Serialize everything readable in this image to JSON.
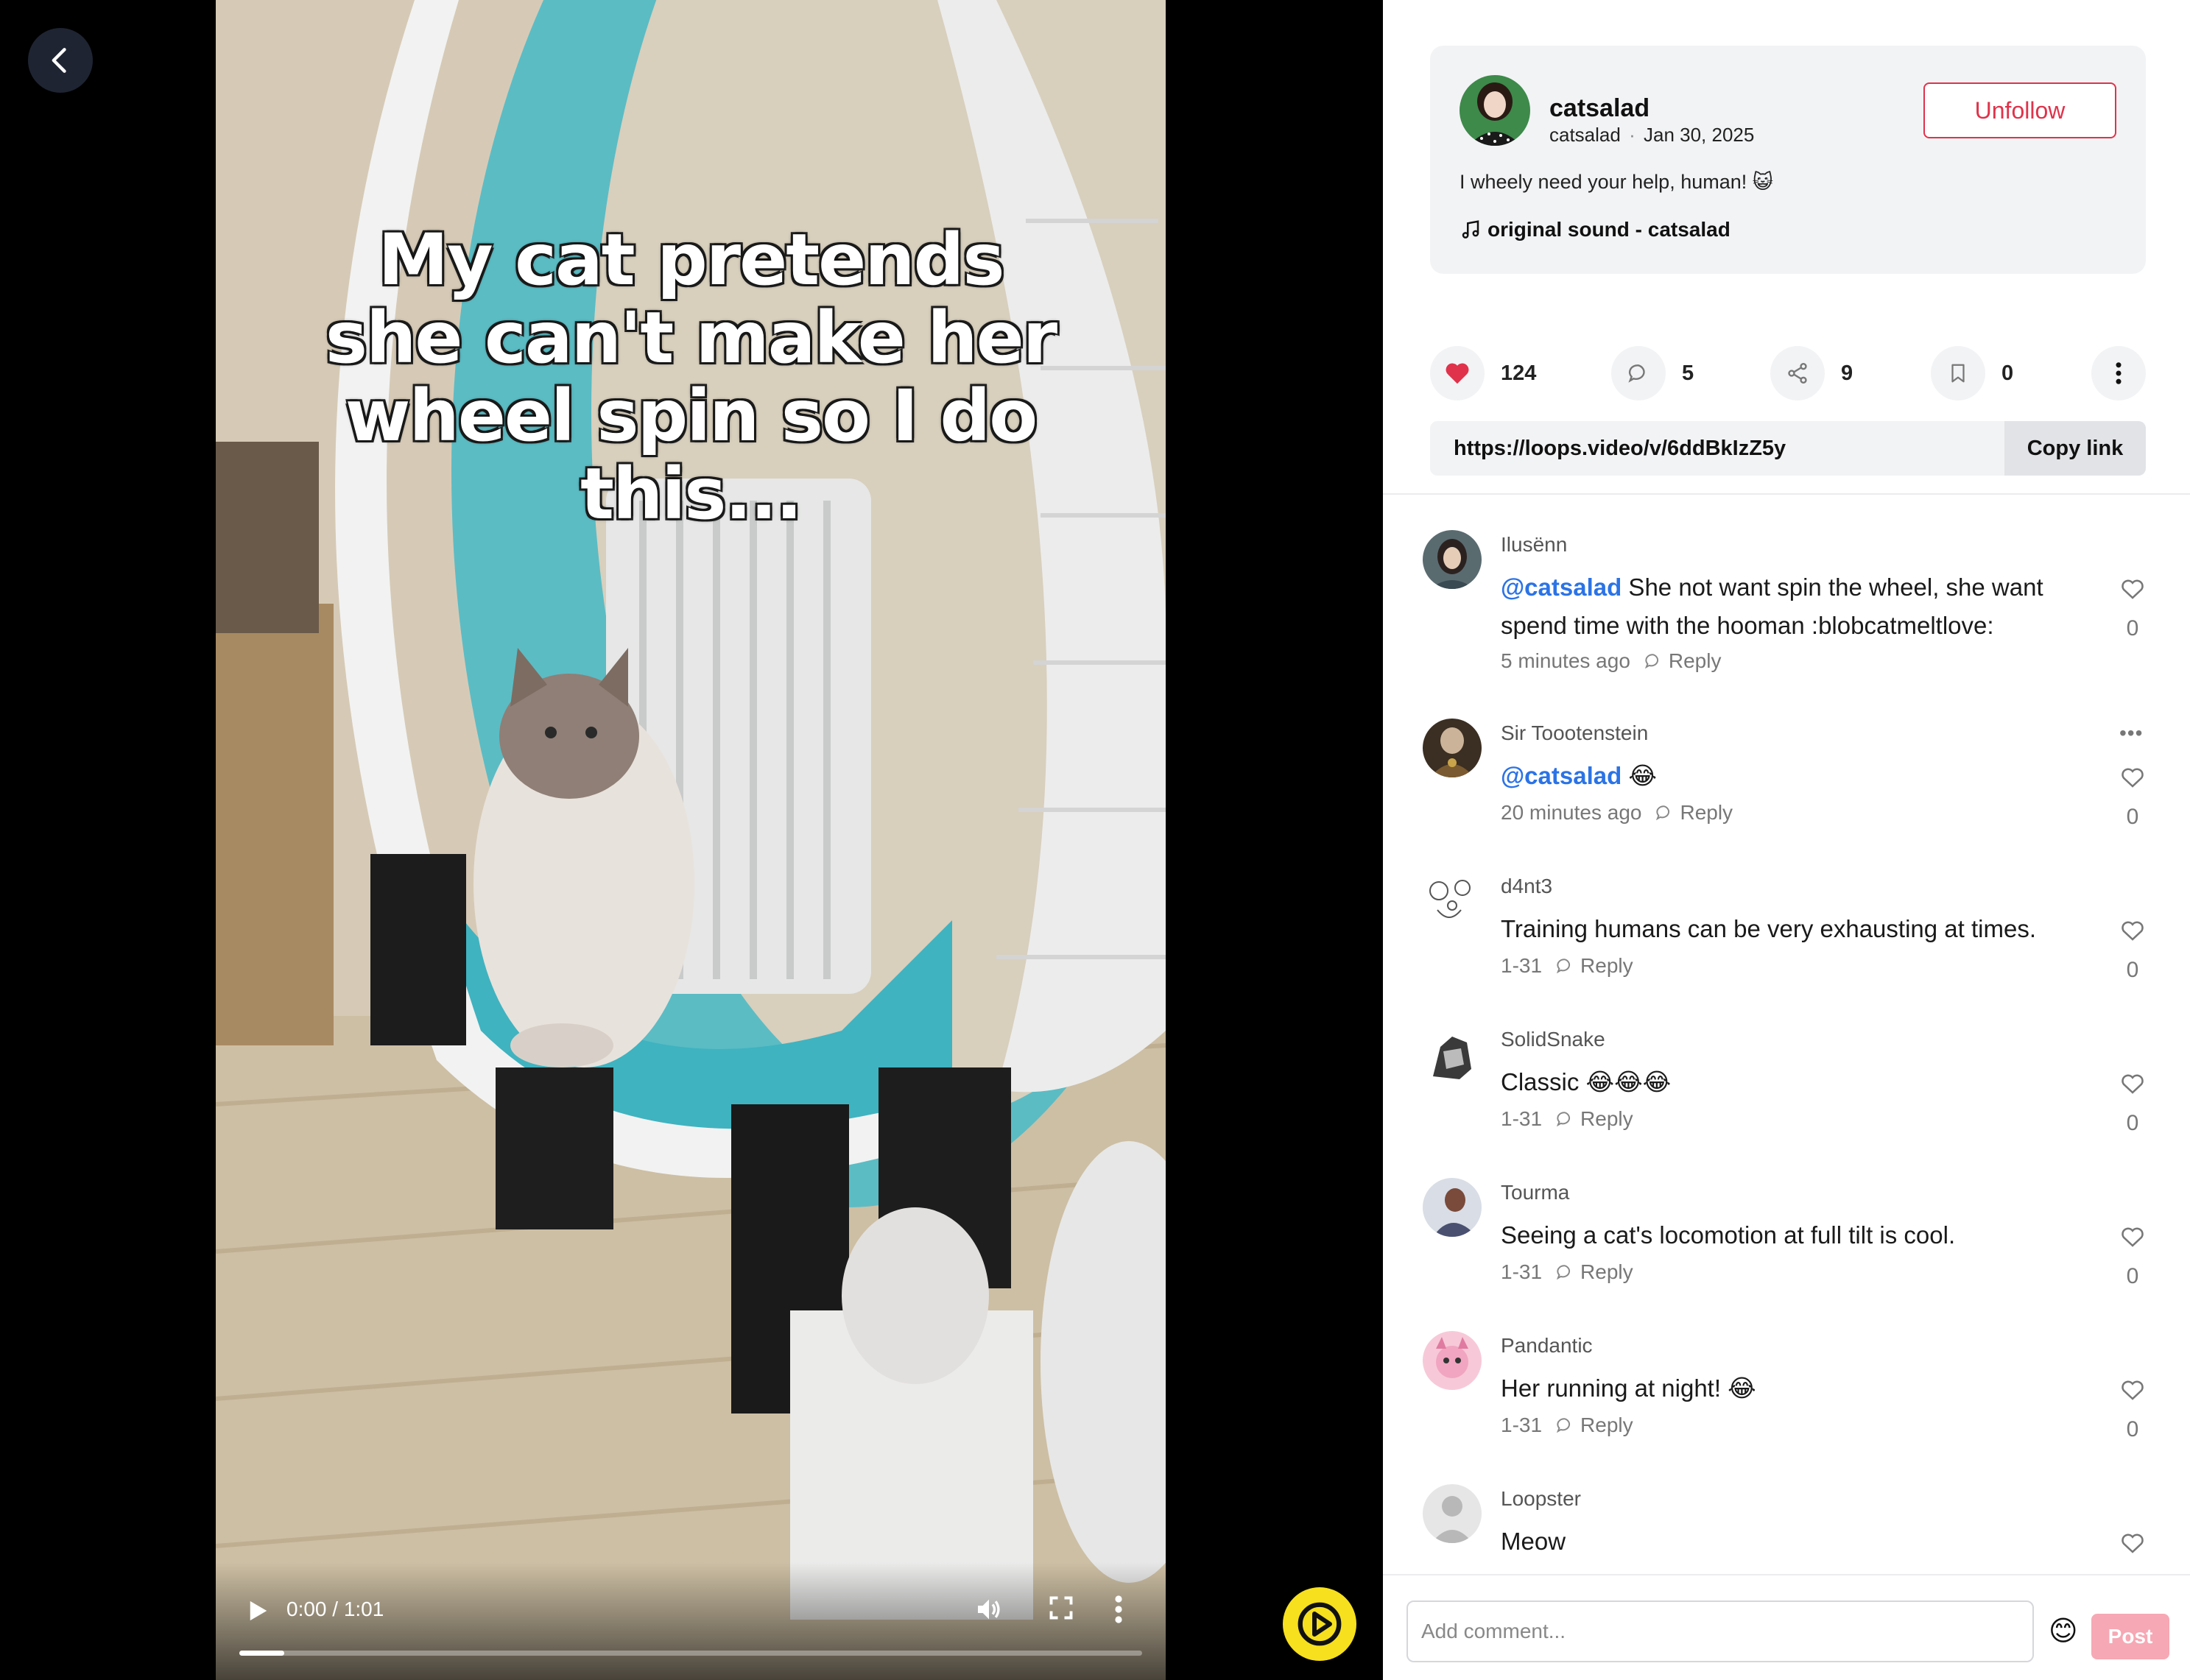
{
  "video": {
    "caption": "My cat pretends she can't make her wheel spin so I do this...",
    "time": "0:00 / 1:01",
    "progress": 0.05
  },
  "author": {
    "name": "catsalad",
    "handle": "catsalad",
    "date": "Jan 30, 2025",
    "separator": "·",
    "follow_label": "Unfollow",
    "caption": "I wheely need your help, human! 😺",
    "sound": "original sound - catsalad"
  },
  "actions": {
    "likes": "124",
    "comments": "5",
    "shares": "9",
    "bookmarks": "0"
  },
  "link": {
    "url": "https://loops.video/v/6ddBkIzZ5y",
    "copy_label": "Copy link"
  },
  "comments": [
    {
      "user": "Ilusënn",
      "mention": "@catsalad",
      "text": " She not want spin the wheel, she want spend time with the hooman :blobcatmeltlove:",
      "time": "5 minutes ago",
      "reply": "Reply",
      "likes": "0"
    },
    {
      "user": "Sir Toootenstein",
      "mention": "@catsalad",
      "text": " 😂",
      "time": "20 minutes ago",
      "reply": "Reply",
      "likes": "0"
    },
    {
      "user": "d4nt3",
      "mention": "",
      "text": "Training humans can be very exhausting at times.",
      "time": "1-31",
      "reply": "Reply",
      "likes": "0"
    },
    {
      "user": "SolidSnake",
      "mention": "",
      "text": "Classic 😂😂😂",
      "time": "1-31",
      "reply": "Reply",
      "likes": "0"
    },
    {
      "user": "Tourma",
      "mention": "",
      "text": "Seeing a cat's locomotion at full tilt is cool.",
      "time": "1-31",
      "reply": "Reply",
      "likes": "0"
    },
    {
      "user": "Pandantic",
      "mention": "",
      "text": "Her running at night! 😂",
      "time": "1-31",
      "reply": "Reply",
      "likes": "0"
    },
    {
      "user": "Loopster",
      "mention": "",
      "text": "Meow",
      "time": "",
      "reply": "",
      "likes": ""
    }
  ],
  "composer": {
    "placeholder": "Add comment...",
    "emoji": "😊",
    "post_label": "Post"
  },
  "colors": {
    "accent_red": "#e0324a",
    "mention_blue": "#2b73e6",
    "logo_yellow": "#f7e01d"
  },
  "icons": [
    "back-arrow-icon",
    "play-icon",
    "volume-icon",
    "fullscreen-icon",
    "more-vertical-icon",
    "heart-icon",
    "comment-icon",
    "share-icon",
    "bookmark-icon",
    "music-note-icon",
    "reply-icon",
    "loops-logo-icon"
  ]
}
